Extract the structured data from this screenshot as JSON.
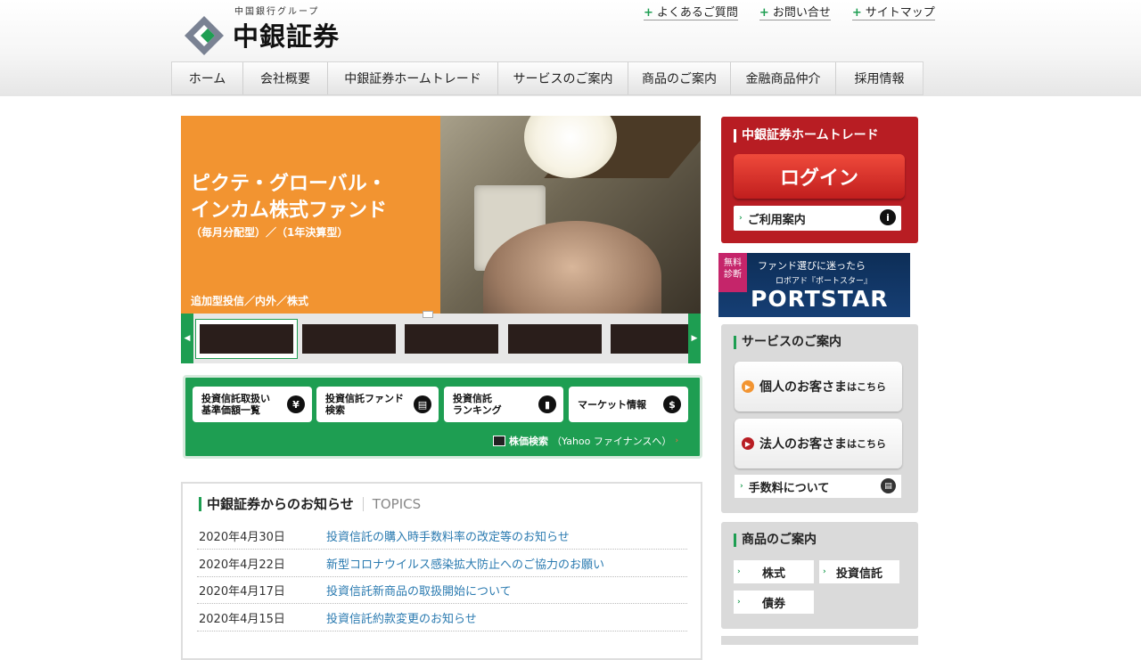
{
  "header": {
    "logo_sub": "中国銀行グループ",
    "logo_name": "中銀証券",
    "utility_links": [
      "よくあるご質問",
      "お問い合せ",
      "サイトマップ"
    ],
    "nav": [
      "ホーム",
      "会社概要",
      "中銀証券ホームトレード",
      "サービスのご案内",
      "商品のご案内",
      "金融商品仲介",
      "採用情報"
    ]
  },
  "hero": {
    "title_line1": "ピクテ・グローバル・",
    "title_line2": "インカム株式ファンド",
    "subtitle": "（毎月分配型）／（1年決算型）",
    "category": "追加型投信／内外／株式"
  },
  "quick_links": {
    "buttons": [
      {
        "line1": "投資信託取扱い",
        "line2": "基準価額一覧",
        "icon": "¥"
      },
      {
        "line1": "投資信託ファンド",
        "line2": "検索",
        "icon": "▤"
      },
      {
        "line1": "投資信託",
        "line2": "ランキング",
        "icon": "▮"
      },
      {
        "line1": "マーケット情報",
        "line2": "",
        "icon": "$"
      }
    ],
    "stock_search": "株価検索",
    "stock_search_note": "（Yahoo ファイナンスへ）"
  },
  "topics": {
    "title": "中銀証券からのお知らせ",
    "title_en": "TOPICS",
    "items": [
      {
        "date": "2020年4月30日",
        "title": "投資信託の購入時手数料率の改定等のお知らせ"
      },
      {
        "date": "2020年4月22日",
        "title": "新型コロナウイルス感染拡大防止へのご協力のお願い"
      },
      {
        "date": "2020年4月17日",
        "title": "投資信託新商品の取扱開始について"
      },
      {
        "date": "2020年4月15日",
        "title": "投資信託約款変更のお知らせ"
      }
    ]
  },
  "sidebar": {
    "login_heading": "中銀証券ホームトレード",
    "login_button": "ログイン",
    "usage_guide": "ご利用案内",
    "portstar": {
      "badge_line1": "無料",
      "badge_line2": "診断",
      "line1": "ファンド選びに迷ったら",
      "line2": "ロボアド『ポートスター』",
      "logo": "PORTSTAR"
    },
    "service_heading": "サービスのご案内",
    "individual": "個人のお客さま",
    "corporate": "法人のお客さま",
    "here_suffix": "はこちら",
    "fees": "手数料について",
    "products_heading": "商品のご案内",
    "products": [
      "株式",
      "投資信託",
      "債券"
    ]
  }
}
